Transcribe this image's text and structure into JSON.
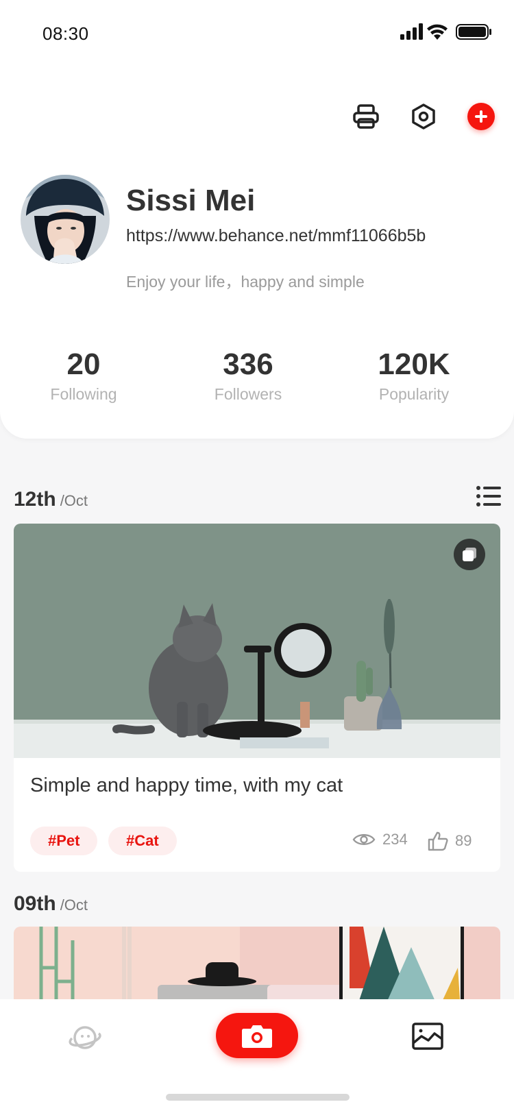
{
  "status_bar": {
    "time": "08:30"
  },
  "header": {
    "icons": [
      "printer-icon",
      "settings-hex-icon",
      "add-icon"
    ]
  },
  "profile": {
    "name": "Sissi Mei",
    "url": "https://www.behance.net/mmf11066b5b",
    "bio": "Enjoy your life，happy and simple"
  },
  "stats": [
    {
      "value": "20",
      "label": "Following"
    },
    {
      "value": "336",
      "label": "Followers"
    },
    {
      "value": "120K",
      "label": "Popularity"
    }
  ],
  "feed": {
    "posts": [
      {
        "day": "12th",
        "month": "/Oct",
        "title": "Simple and happy time, with my cat",
        "tags": [
          "#Pet",
          "#Cat"
        ],
        "views": "234",
        "likes": "89"
      },
      {
        "day": "09th",
        "month": "/Oct"
      }
    ]
  },
  "tabbar": {
    "items": [
      "planet-icon",
      "camera-icon",
      "gallery-icon"
    ]
  },
  "colors": {
    "accent": "#f5160f",
    "tag_bg": "#fdeeee",
    "page_bg": "#f6f6f7"
  }
}
